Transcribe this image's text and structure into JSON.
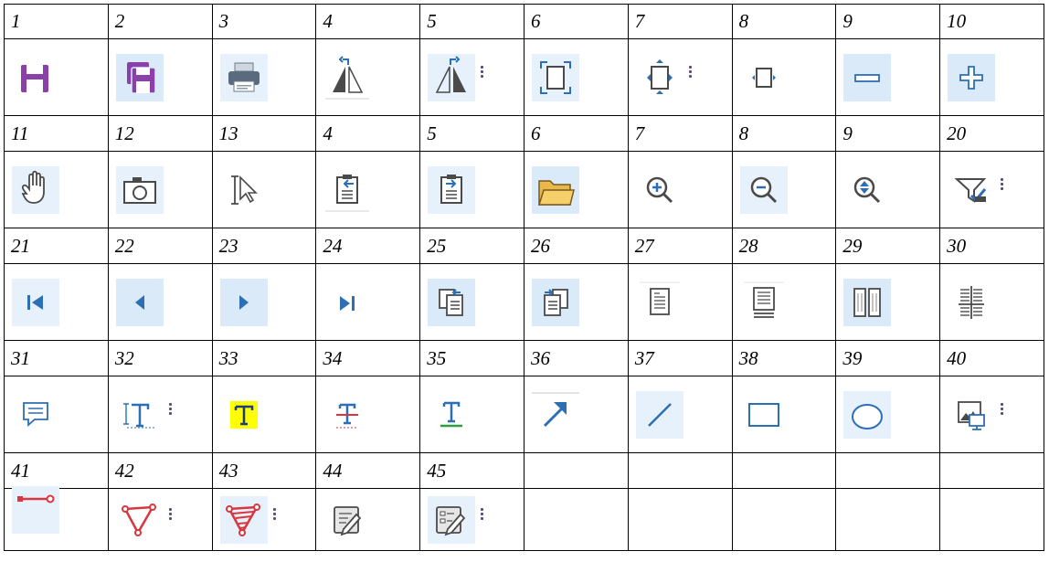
{
  "rows": [
    {
      "numbers": [
        "1",
        "2",
        "3",
        "4",
        "5",
        "6",
        "7",
        "8",
        "9",
        "10"
      ],
      "icons": [
        "save-icon",
        "save-all-icon",
        "print-icon",
        "flip-horizontal-icon",
        "flip-vertical-icon",
        "fit-page-icon",
        "fit-width-icon",
        "actual-size-icon",
        "minus-icon",
        "plus-icon"
      ]
    },
    {
      "numbers": [
        "11",
        "12",
        "13",
        "4",
        "5",
        "6",
        "7",
        "8",
        "9",
        "20"
      ],
      "icons": [
        "hand-tool-icon",
        "camera-icon",
        "text-select-icon",
        "import-document-icon",
        "export-document-icon",
        "folder-icon",
        "zoom-in-icon",
        "zoom-out-icon",
        "zoom-fit-icon",
        "filter-check-icon"
      ]
    },
    {
      "numbers": [
        "21",
        "22",
        "23",
        "24",
        "25",
        "26",
        "27",
        "28",
        "29",
        "30"
      ],
      "icons": [
        "first-page-icon",
        "previous-page-icon",
        "next-page-icon",
        "last-page-icon",
        "previous-document-icon",
        "next-document-icon",
        "single-page-icon",
        "continuous-page-icon",
        "two-page-icon",
        "split-view-icon"
      ]
    },
    {
      "numbers": [
        "31",
        "32",
        "33",
        "34",
        "35",
        "36",
        "37",
        "38",
        "39",
        "40"
      ],
      "icons": [
        "comment-icon",
        "insert-text-icon",
        "highlight-text-icon",
        "strikeout-text-icon",
        "underline-text-icon",
        "arrow-icon",
        "line-icon",
        "rectangle-icon",
        "ellipse-icon",
        "stamp-image-icon"
      ]
    },
    {
      "numbers": [
        "41",
        "42",
        "43",
        "44",
        "45",
        "",
        "",
        "",
        "",
        ""
      ],
      "icons": [
        "distance-measure-icon",
        "polygon-icon",
        "polygon-hatched-icon",
        "edit-document-icon",
        "edit-form-icon",
        "",
        "",
        "",
        "",
        ""
      ]
    }
  ],
  "colors": {
    "highlight_bg": "#dbeaf9",
    "icon_blue": "#2c6fb5",
    "purple": "#8b3fa8",
    "red": "#d9363e",
    "yellow": "#ffff00",
    "green": "#2e9e3e"
  }
}
